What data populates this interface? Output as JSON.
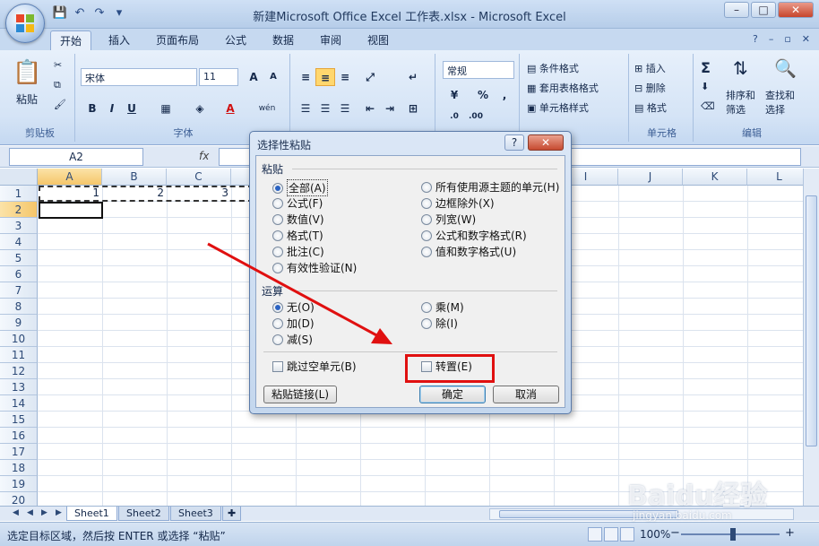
{
  "window": {
    "title": "新建Microsoft Office Excel 工作表.xlsx - Microsoft Excel",
    "min": "–",
    "max": "□",
    "close": "✕"
  },
  "qat": {
    "save": "💾",
    "undo": "↶",
    "redo": "↷",
    "customize": "▾"
  },
  "tabs": [
    "开始",
    "插入",
    "页面布局",
    "公式",
    "数据",
    "审阅",
    "视图"
  ],
  "ribbon": {
    "clipboard": {
      "paste": "粘贴",
      "label": "剪贴板"
    },
    "font": {
      "name": "宋体",
      "size": "11",
      "label": "字体",
      "bold": "B",
      "italic": "I",
      "underline": "U",
      "grow": "A",
      "shrink": "A",
      "color_letter": "A",
      "wen": "wén"
    },
    "number": {
      "format": "常规",
      "percent": "%",
      "comma": ",",
      "label": "数字"
    },
    "styles": {
      "conditional": "条件格式",
      "table": "套用表格格式",
      "cell": "单元格样式",
      "label": "样式"
    },
    "cells": {
      "insert": "插入",
      "delete": "删除",
      "format": "格式",
      "label": "单元格"
    },
    "editing": {
      "sigma": "Σ",
      "sort": "排序和\n筛选",
      "find": "查找和\n选择",
      "sort1": "排序和",
      "sort2": "筛选",
      "find1": "查找和",
      "find2": "选择",
      "label": "编辑"
    }
  },
  "formula_bar": {
    "name_box": "A2",
    "fx": "fx"
  },
  "grid": {
    "columns": [
      "A",
      "B",
      "C",
      "D",
      "E",
      "F",
      "G",
      "H",
      "I",
      "J",
      "K",
      "L"
    ],
    "rows": [
      "1",
      "2",
      "3",
      "4",
      "5",
      "6",
      "7",
      "8",
      "9",
      "10",
      "11",
      "12",
      "13",
      "14",
      "15",
      "16",
      "17",
      "18",
      "19",
      "20"
    ],
    "cells": {
      "A1": "1",
      "B1": "2",
      "C1": "3"
    }
  },
  "sheets": [
    "Sheet1",
    "Sheet2",
    "Sheet3"
  ],
  "status": {
    "message": "选定目标区域，然后按 ENTER 或选择 “粘贴”",
    "zoom": "100%",
    "minus": "−",
    "plus": "+"
  },
  "watermark": {
    "logo": "Baidu经验",
    "url": "jingyan.baidu.com"
  },
  "dialog": {
    "title": "选择性粘贴",
    "help": "?",
    "close": "✕",
    "paste_section": "粘贴",
    "paste_options_left": [
      "全部(A)",
      "公式(F)",
      "数值(V)",
      "格式(T)",
      "批注(C)",
      "有效性验证(N)"
    ],
    "paste_options_right": [
      "所有使用源主题的单元(H)",
      "边框除外(X)",
      "列宽(W)",
      "公式和数字格式(R)",
      "值和数字格式(U)"
    ],
    "operation_section": "运算",
    "operation_left": [
      "无(O)",
      "加(D)",
      "减(S)"
    ],
    "operation_right": [
      "乘(M)",
      "除(I)"
    ],
    "skip_blanks": "跳过空单元(B)",
    "transpose": "转置(E)",
    "paste_link": "粘贴链接(L)",
    "ok": "确定",
    "cancel": "取消"
  },
  "colors": {
    "annotation": "#e01010",
    "ribbon": "#d5e4f6",
    "selection": "#f5c66a"
  }
}
